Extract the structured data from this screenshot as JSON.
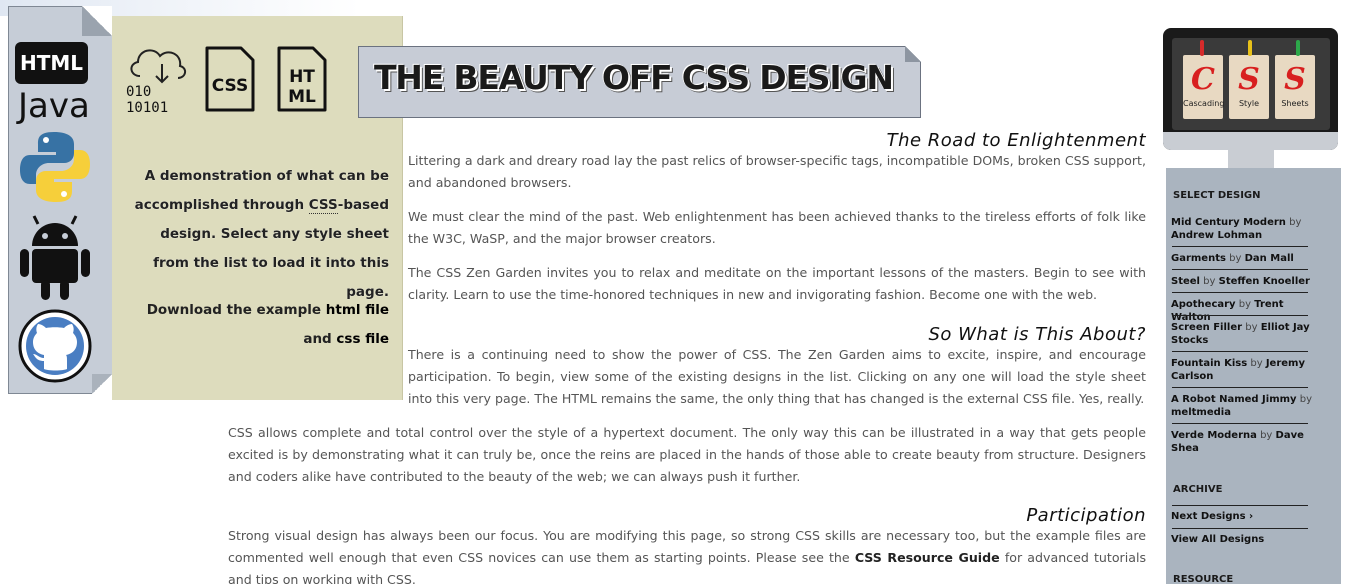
{
  "left_icons": {
    "html_badge": "HTML",
    "java_label": "Java"
  },
  "intro": {
    "cloud_binary": [
      "010",
      "10101"
    ],
    "file_css": "CSS",
    "file_html": [
      "HT",
      "ML"
    ],
    "lead": "A demonstration of what can be accomplished through ",
    "lead_abbr": "CSS",
    "lead_rest": "-based design. Select any style sheet from the list to load it into this page.",
    "download_prefix": "Download the example ",
    "download_html": "html file",
    "download_mid": " and ",
    "download_css": "css file"
  },
  "banner": {
    "title": "THE BEAUTY OFF CSS DESIGN"
  },
  "sections": [
    {
      "title": "The Road to Enlightenment",
      "paragraphs": [
        "Littering a dark and dreary road lay the past relics of browser-specific tags, incompatible DOMs, broken CSS support, and abandoned browsers.",
        "We must clear the mind of the past. Web enlightenment has been achieved thanks to the tireless efforts of folk like the W3C, WaSP, and the major browser creators.",
        "The CSS Zen Garden invites you to relax and meditate on the important lessons of the masters. Begin to see with clarity. Learn to use the time-honored techniques in new and invigorating fashion. Become one with the web."
      ]
    },
    {
      "title": "So What is This About?",
      "paragraphs": [
        "There is a continuing need to show the power of CSS. The Zen Garden aims to excite, inspire, and encourage participation. To begin, view some of the existing designs in the list. Clicking on any one will load the style sheet into this very page. The HTML remains the same, the only thing that has changed is the external CSS file. Yes, really.",
        "CSS allows complete and total control over the style of a hypertext document. The only way this can be illustrated in a way that gets people excited is by demonstrating what it can truly be, once the reins are placed in the hands of those able to create beauty from structure. Designers and coders alike have contributed to the beauty of the web; we can always push it further."
      ]
    },
    {
      "title": "Participation",
      "paragraph_prefix": "Strong visual design has always been our focus. You are modifying this page, so strong CSS skills are necessary too, but the example files are commented well enough that even CSS novices can use them as starting points. Please see the ",
      "paragraph_link": "CSS Resource Guide",
      "paragraph_suffix": " for advanced tutorials and tips on working with CSS."
    }
  ],
  "monitor": {
    "letters": [
      "C",
      "S",
      "S"
    ],
    "words": [
      "Cascading",
      "Style",
      "Sheets"
    ],
    "pin_colors": [
      "#d62b2b",
      "#e8c11a",
      "#2ca84a"
    ]
  },
  "sidebar": {
    "select_heading": "SELECT DESIGN",
    "designs": [
      {
        "name": "Mid Century Modern",
        "by": "by",
        "author": "Andrew Lohman"
      },
      {
        "name": "Garments",
        "by": "by",
        "author": "Dan Mall"
      },
      {
        "name": "Steel",
        "by": "by",
        "author": "Steffen Knoeller"
      },
      {
        "name": "Apothecary",
        "by": "by",
        "author": "Trent Walton"
      },
      {
        "name": "Screen Filler",
        "by": "by",
        "author": "Elliot Jay Stocks"
      },
      {
        "name": "Fountain Kiss",
        "by": "by",
        "author": "Jeremy Carlson"
      },
      {
        "name": "A Robot Named Jimmy",
        "by": "by",
        "author": "meltmedia"
      },
      {
        "name": "Verde Moderna",
        "by": "by",
        "author": "Dave Shea"
      }
    ],
    "archive_heading": "ARCHIVE",
    "next_designs": "Next Designs ›",
    "view_all": "View All Designs",
    "resource_heading": "RESOURCE"
  }
}
